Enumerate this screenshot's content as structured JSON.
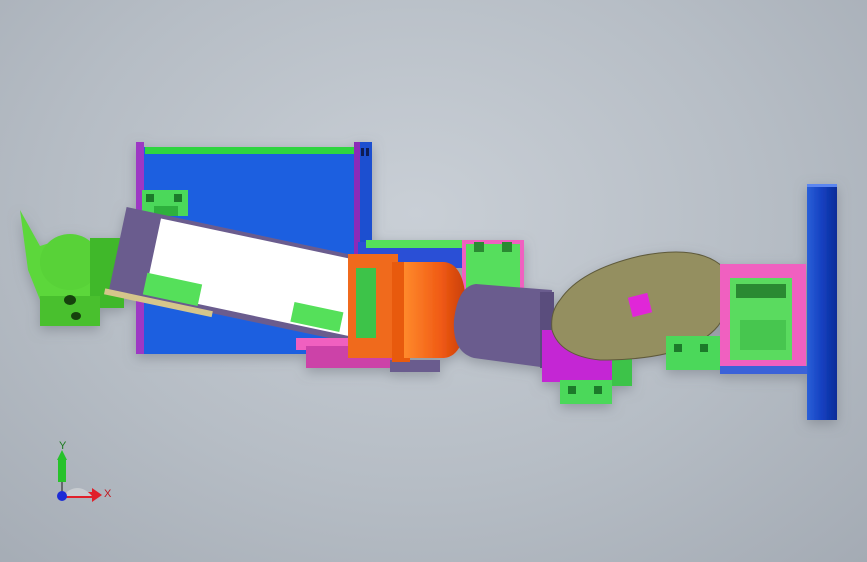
{
  "viewport": {
    "background_color": "#b9c0c8"
  },
  "triad": {
    "x_label": "X",
    "y_label": "Y",
    "x_color": "#e0202a",
    "y_color": "#27c22b",
    "z_color": "#1c2bd6"
  },
  "colors": {
    "blue_plate": "#1f5fe0",
    "dark_blue": "#1438b8",
    "green_part": "#55e05a",
    "lime_claw": "#5cd73a",
    "violet_link": "#6a5c8e",
    "orange_joint": "#f0601a",
    "olive_disc": "#948f61",
    "magenta_part": "#d02ad0",
    "pink_frame": "#f060c0"
  }
}
